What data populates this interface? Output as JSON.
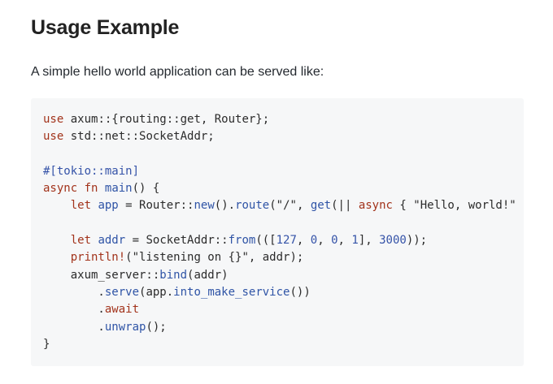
{
  "section": {
    "heading": "Usage Example",
    "intro": "A simple hello world application can be served like:"
  },
  "code": {
    "language": "rust",
    "lines": [
      [
        {
          "t": "kw",
          "v": "use"
        },
        {
          "t": "plain",
          "v": " axum::{routing::get, Router};"
        }
      ],
      [
        {
          "t": "kw",
          "v": "use"
        },
        {
          "t": "plain",
          "v": " std::net::SocketAddr;"
        }
      ],
      [],
      [
        {
          "t": "attr",
          "v": "#[tokio::main]"
        }
      ],
      [
        {
          "t": "kw",
          "v": "async"
        },
        {
          "t": "plain",
          "v": " "
        },
        {
          "t": "kw",
          "v": "fn"
        },
        {
          "t": "plain",
          "v": " "
        },
        {
          "t": "fn",
          "v": "main"
        },
        {
          "t": "plain",
          "v": "() {"
        }
      ],
      [
        {
          "t": "plain",
          "v": "    "
        },
        {
          "t": "kw",
          "v": "let"
        },
        {
          "t": "plain",
          "v": " "
        },
        {
          "t": "fn",
          "v": "app"
        },
        {
          "t": "plain",
          "v": " = Router::"
        },
        {
          "t": "fn",
          "v": "new"
        },
        {
          "t": "plain",
          "v": "()."
        },
        {
          "t": "fn",
          "v": "route"
        },
        {
          "t": "plain",
          "v": "("
        },
        {
          "t": "str",
          "v": "\"/\""
        },
        {
          "t": "plain",
          "v": ", "
        },
        {
          "t": "fn",
          "v": "get"
        },
        {
          "t": "plain",
          "v": "(|| "
        },
        {
          "t": "kw",
          "v": "async"
        },
        {
          "t": "plain",
          "v": " { "
        },
        {
          "t": "str",
          "v": "\"Hello, world!\""
        },
        {
          "t": "plain",
          "v": " }));"
        }
      ],
      [],
      [
        {
          "t": "plain",
          "v": "    "
        },
        {
          "t": "kw",
          "v": "let"
        },
        {
          "t": "plain",
          "v": " "
        },
        {
          "t": "fn",
          "v": "addr"
        },
        {
          "t": "plain",
          "v": " = SocketAddr::"
        },
        {
          "t": "fn",
          "v": "from"
        },
        {
          "t": "plain",
          "v": "((["
        },
        {
          "t": "num",
          "v": "127"
        },
        {
          "t": "plain",
          "v": ", "
        },
        {
          "t": "num",
          "v": "0"
        },
        {
          "t": "plain",
          "v": ", "
        },
        {
          "t": "num",
          "v": "0"
        },
        {
          "t": "plain",
          "v": ", "
        },
        {
          "t": "num",
          "v": "1"
        },
        {
          "t": "plain",
          "v": "], "
        },
        {
          "t": "num",
          "v": "3000"
        },
        {
          "t": "plain",
          "v": "));"
        }
      ],
      [
        {
          "t": "plain",
          "v": "    "
        },
        {
          "t": "mac",
          "v": "println!"
        },
        {
          "t": "plain",
          "v": "("
        },
        {
          "t": "str",
          "v": "\"listening on {}\""
        },
        {
          "t": "plain",
          "v": ", addr);"
        }
      ],
      [
        {
          "t": "plain",
          "v": "    axum_server::"
        },
        {
          "t": "fn",
          "v": "bind"
        },
        {
          "t": "plain",
          "v": "(addr)"
        }
      ],
      [
        {
          "t": "plain",
          "v": "        ."
        },
        {
          "t": "fn",
          "v": "serve"
        },
        {
          "t": "plain",
          "v": "(app."
        },
        {
          "t": "fn",
          "v": "into_make_service"
        },
        {
          "t": "plain",
          "v": "())"
        }
      ],
      [
        {
          "t": "plain",
          "v": "        ."
        },
        {
          "t": "kw",
          "v": "await"
        }
      ],
      [
        {
          "t": "plain",
          "v": "        ."
        },
        {
          "t": "fn",
          "v": "unwrap"
        },
        {
          "t": "plain",
          "v": "();"
        }
      ],
      [
        {
          "t": "plain",
          "v": "}"
        }
      ]
    ]
  },
  "colors": {
    "keyword": "#a2331b",
    "function": "#2f54a6",
    "number": "#3553a8",
    "code_background": "#f6f7f8"
  }
}
